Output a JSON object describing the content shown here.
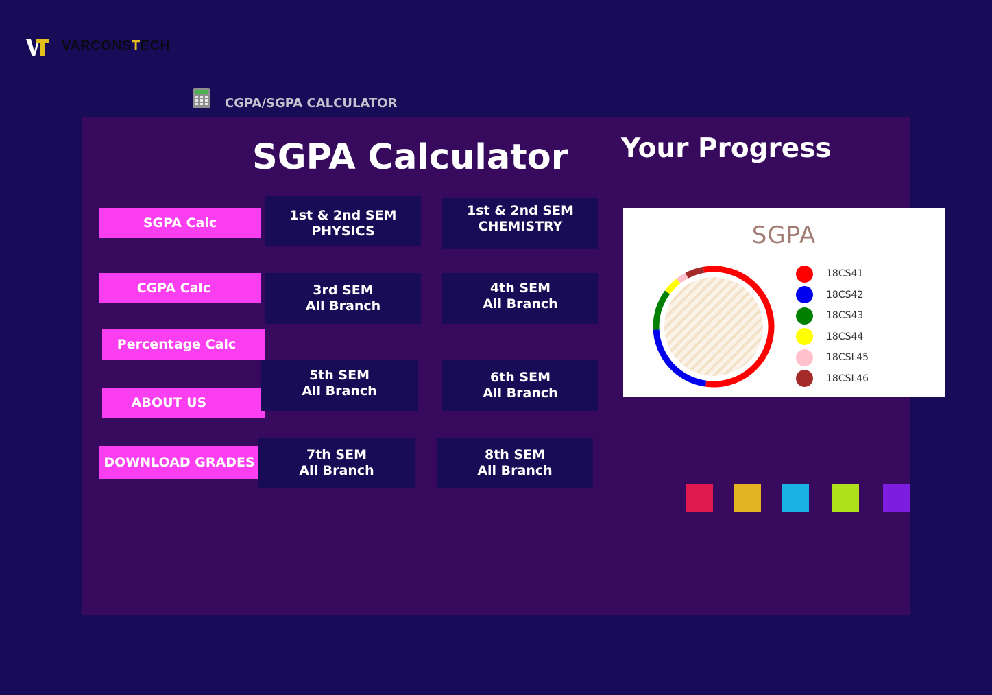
{
  "brand": {
    "mark": "VT",
    "name_prefix": "VARCONS",
    "name_accent": "T",
    "name_suffix": "ECH"
  },
  "header": {
    "icon": "calculator-icon",
    "title": "CGPA/SGPA CALCULATOR"
  },
  "main": {
    "title": "SGPA Calculator",
    "progress_title": "Your Progress"
  },
  "nav": {
    "sgpa": "SGPA Calc",
    "cgpa": "CGPA Calc",
    "percentage": "Percentage Calc",
    "about": "ABOUT US",
    "download": "DOWNLOAD GRADES"
  },
  "sems": {
    "s12_physics": "1st & 2nd SEM\nPHYSICS",
    "s12_chemistry": "1st & 2nd SEM\nCHEMISTRY",
    "s3": "3rd SEM\nAll Branch",
    "s4": "4th SEM\nAll Branch",
    "s5": "5th SEM\nAll Branch",
    "s6": "6th  SEM\nAll Branch",
    "s7": "7th SEM\nAll Branch",
    "s8": "8th SEM\nAll Branch"
  },
  "chart_data": {
    "type": "pie",
    "title": "SGPA",
    "donut": true,
    "categories": [
      "18CS41",
      "18CS42",
      "18CS43",
      "18CS44",
      "18CSL45",
      "18CSL46"
    ],
    "values": [
      50,
      20,
      10,
      4,
      2.5,
      4.5
    ],
    "colors": [
      "#ff0000",
      "#0000ee",
      "#008000",
      "#ffff00",
      "#ffc0cb",
      "#a52a2a"
    ],
    "legend_position": "right"
  },
  "swatches": [
    "#e01a4f",
    "#e2b321",
    "#17b1e3",
    "#b0e01a",
    "#7d1de0"
  ]
}
